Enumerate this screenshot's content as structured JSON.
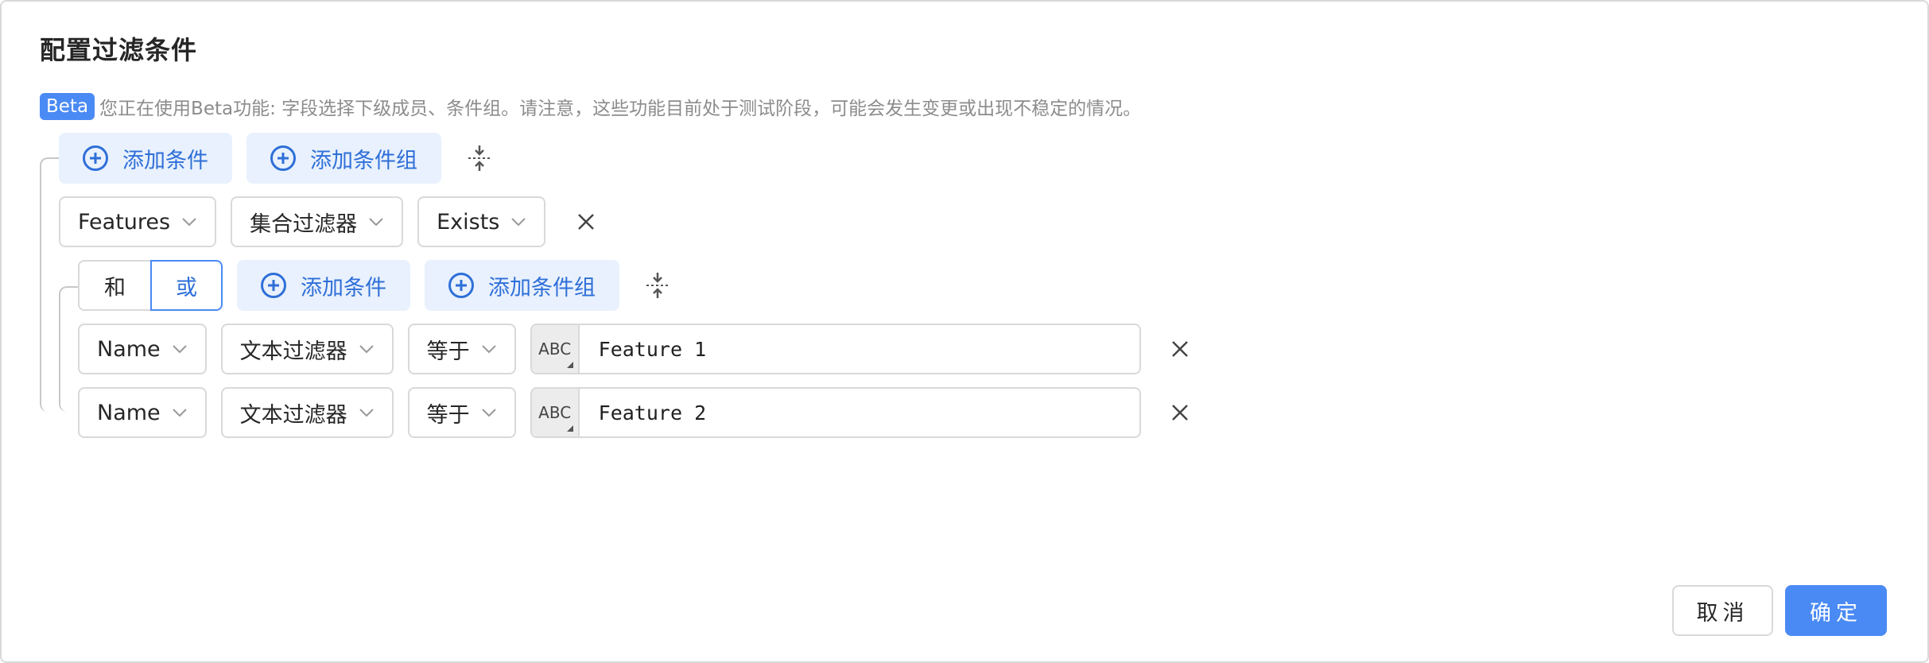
{
  "dialog": {
    "title": "配置过滤条件",
    "beta_badge": "Beta",
    "beta_notice": "您正在使用Beta功能: 字段选择下级成员、条件组。请注意，这些功能目前处于测试阶段，可能会发生变更或出现不稳定的情况。"
  },
  "root_group": {
    "add_condition_label": "添加条件",
    "add_group_label": "添加条件组",
    "condition": {
      "field": "Features",
      "filter_type": "集合过滤器",
      "operator": "Exists"
    }
  },
  "sub_group": {
    "logic_and": "和",
    "logic_or": "或",
    "logic_selected": "或",
    "add_condition_label": "添加条件",
    "add_group_label": "添加条件组",
    "conditions": [
      {
        "field": "Name",
        "filter_type": "文本过滤器",
        "operator": "等于",
        "value_type": "ABC",
        "value": "Feature 1"
      },
      {
        "field": "Name",
        "filter_type": "文本过滤器",
        "operator": "等于",
        "value_type": "ABC",
        "value": "Feature 2"
      }
    ]
  },
  "footer": {
    "cancel_label": "取消",
    "ok_label": "确定"
  },
  "colors": {
    "primary": "#4a8af4",
    "primary_text": "#2f6fd8",
    "add_button_bg": "#e8f1fd",
    "border": "#d9d9d9"
  },
  "icons": [
    "plus-circle-icon",
    "collapse-icon",
    "chevron-down-icon",
    "close-icon"
  ]
}
